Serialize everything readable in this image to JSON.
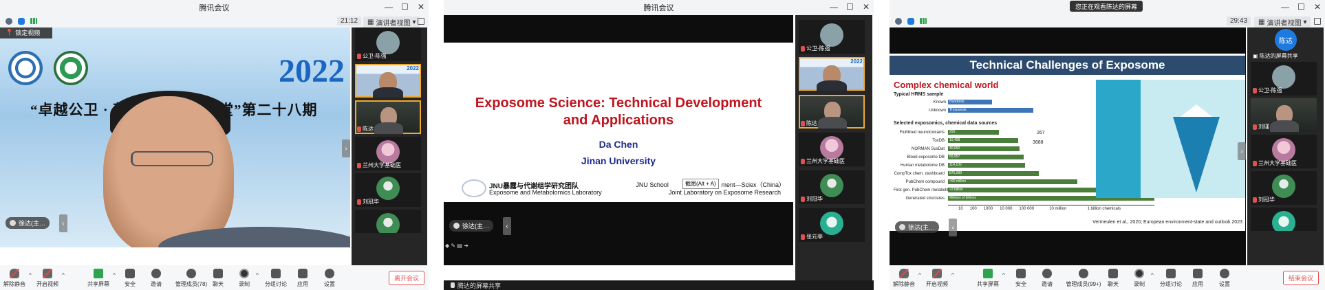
{
  "windows": [
    {
      "title": "腾讯会议",
      "timer": "21:12",
      "view_label": "演讲者视图",
      "pinned_label": "锁定视频",
      "slide": {
        "year": "2022",
        "headline": "“卓越公卫 · 若",
        "headline_tail": "讲堂”第二十八期"
      },
      "float_label": "徐达(主…",
      "thumbs": [
        {
          "label": "公卫-陈强"
        },
        {
          "label": "2022"
        },
        {
          "label": "陈达"
        },
        {
          "label": "兰州大学基础医"
        },
        {
          "label": "刘冠华"
        }
      ],
      "toolbar": {
        "mute": "解除静音",
        "video": "开启视频",
        "share": "共享屏幕",
        "security": "安全",
        "invite": "邀请",
        "members": "管理成员(78)",
        "chat": "聊天",
        "record": "录制",
        "breakout": "分组讨论",
        "apps": "应用",
        "settings": "设置",
        "leave": "离开会议"
      }
    },
    {
      "title": "腾讯会议",
      "slide": {
        "title_line1": "Exposome Science: Technical Development",
        "title_line2": "and Applications",
        "author": "Da Chen",
        "institution": "Jinan University",
        "lab_cn": "JNU暴露与代谢组学研究团队",
        "lab_en": "Exposome and Metabolomics Laboratory",
        "partner_line1": "JNU School",
        "partner_tooltip": "截图(Alt + A)",
        "partner_line1_tail": "ment—Sciex（China）",
        "partner_line2": "Joint Laboratory on Exposome Research"
      },
      "float_label": "徐达(主…",
      "thumbs": [
        {
          "label": "公卫-陈强"
        },
        {
          "label": "2022"
        },
        {
          "label": "陈达"
        },
        {
          "label": "兰州大学基础医"
        },
        {
          "label": "刘冠华"
        },
        {
          "label": "张元亭"
        }
      ],
      "bottom_label": "腾达的屏幕共享"
    },
    {
      "title": "",
      "share_banner": "您正在观看陈达的屏幕",
      "timer": "29:43",
      "view_label": "演讲者视图",
      "slide": {
        "banner": "Technical Challenges of Exposome",
        "subtitle": "Complex chemical world",
        "hrms_label": "Typical HRMS sample",
        "known_label": "Known",
        "known_value": "Hundreds",
        "unknown_label": "Unknown",
        "unknown_value": "Thousands",
        "selected_label": "Selected exposomics, chemical data sources",
        "rows": [
          {
            "label": "FluMined neurotoxicants",
            "value": "250"
          },
          {
            "label": "ToxDB",
            "value": "16,498"
          },
          {
            "label": "NORMAN SusDat",
            "value": "40,052"
          },
          {
            "label": "Blood exposome DB",
            "value": "65,957"
          },
          {
            "label": "Human metabolome DB",
            "value": "114,100"
          },
          {
            "label": "CompTox chem. dashboard",
            "value": "875,000"
          },
          {
            "label": "PubChem compound",
            "value": ">96 million"
          },
          {
            "label": "First gen. PubChem metabolites",
            "value": ">2 billion"
          },
          {
            "label": "Generated structures",
            "value": "Millions of billions"
          }
        ],
        "brace1": "267",
        "brace2": "3688",
        "ticks": [
          "10",
          "100",
          "1000",
          "10 000",
          "100 000",
          "10 million",
          "1 billion chemicals"
        ],
        "citation": "Vermeulen et al., 2020; European environment-state and outlook 2023"
      },
      "float_label": "徐达(主…",
      "avatar_label": "陈达",
      "thumbs": [
        {
          "label": "陈达的屏幕共享"
        },
        {
          "label": "公卫-陈强"
        },
        {
          "label": "刘瑾"
        },
        {
          "label": "兰州大学基础医"
        },
        {
          "label": "刘冠华"
        }
      ],
      "toolbar": {
        "mute": "解除静音",
        "video": "开启视频",
        "share": "共享屏幕",
        "security": "安全",
        "invite": "邀请",
        "members": "管理成员(99+)",
        "chat": "聊天",
        "record": "录制",
        "breakout": "分组讨论",
        "apps": "应用",
        "settings": "设置",
        "leave": "结束会议"
      }
    }
  ]
}
